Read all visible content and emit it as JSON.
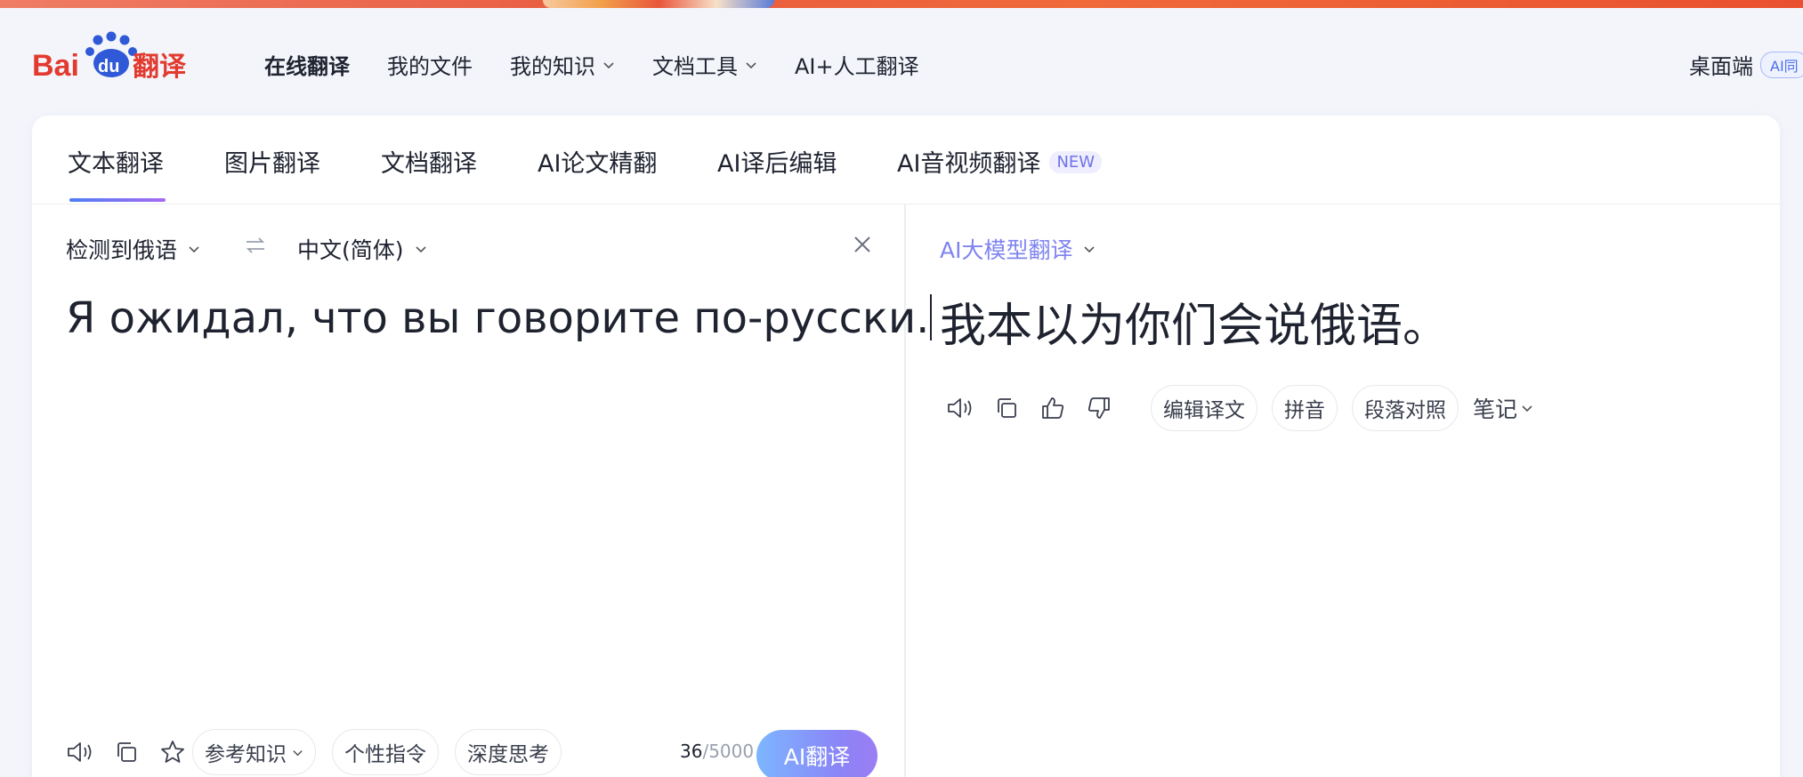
{
  "brand": {
    "logo_text_bai": "Bai",
    "logo_text_du": "du",
    "logo_text_fanyi": "翻译",
    "logo_red": "#e23a2e",
    "logo_blue": "#2f59d6"
  },
  "header": {
    "nav": [
      {
        "label": "在线翻译",
        "has_menu": false,
        "active": true
      },
      {
        "label": "我的文件",
        "has_menu": false
      },
      {
        "label": "我的知识",
        "has_menu": true
      },
      {
        "label": "文档工具",
        "has_menu": true
      },
      {
        "label": "AI+人工翻译",
        "has_menu": false
      }
    ],
    "desktop_label": "桌面端",
    "ai_tag": "AI同"
  },
  "tabs": [
    {
      "label": "文本翻译",
      "active": true
    },
    {
      "label": "图片翻译"
    },
    {
      "label": "文档翻译"
    },
    {
      "label": "AI论文精翻"
    },
    {
      "label": "AI译后编辑"
    },
    {
      "label": "AI音视频翻译",
      "badge": "NEW"
    }
  ],
  "source": {
    "detected_lang": "检测到俄语",
    "target_lang": "中文(简体)",
    "text": "Я ожидал, что вы говорите по-русски.",
    "tools": {
      "knowledge_label": "参考知识",
      "instruction_label": "个性指令",
      "deep_think_label": "深度思考"
    },
    "char_count": "36",
    "char_max": "/5000",
    "translate_button": "AI翻译"
  },
  "target": {
    "model_label": "AI大模型翻译",
    "text": "我本以为你们会说俄语。",
    "buttons": {
      "edit": "编辑译文",
      "pinyin": "拼音",
      "paragraph": "段落对照",
      "notes": "笔记"
    }
  },
  "colors": {
    "accent_gradient_start": "#7cb6ff",
    "accent_gradient_end": "#9c7df4",
    "model_label": "#7f84f0"
  }
}
